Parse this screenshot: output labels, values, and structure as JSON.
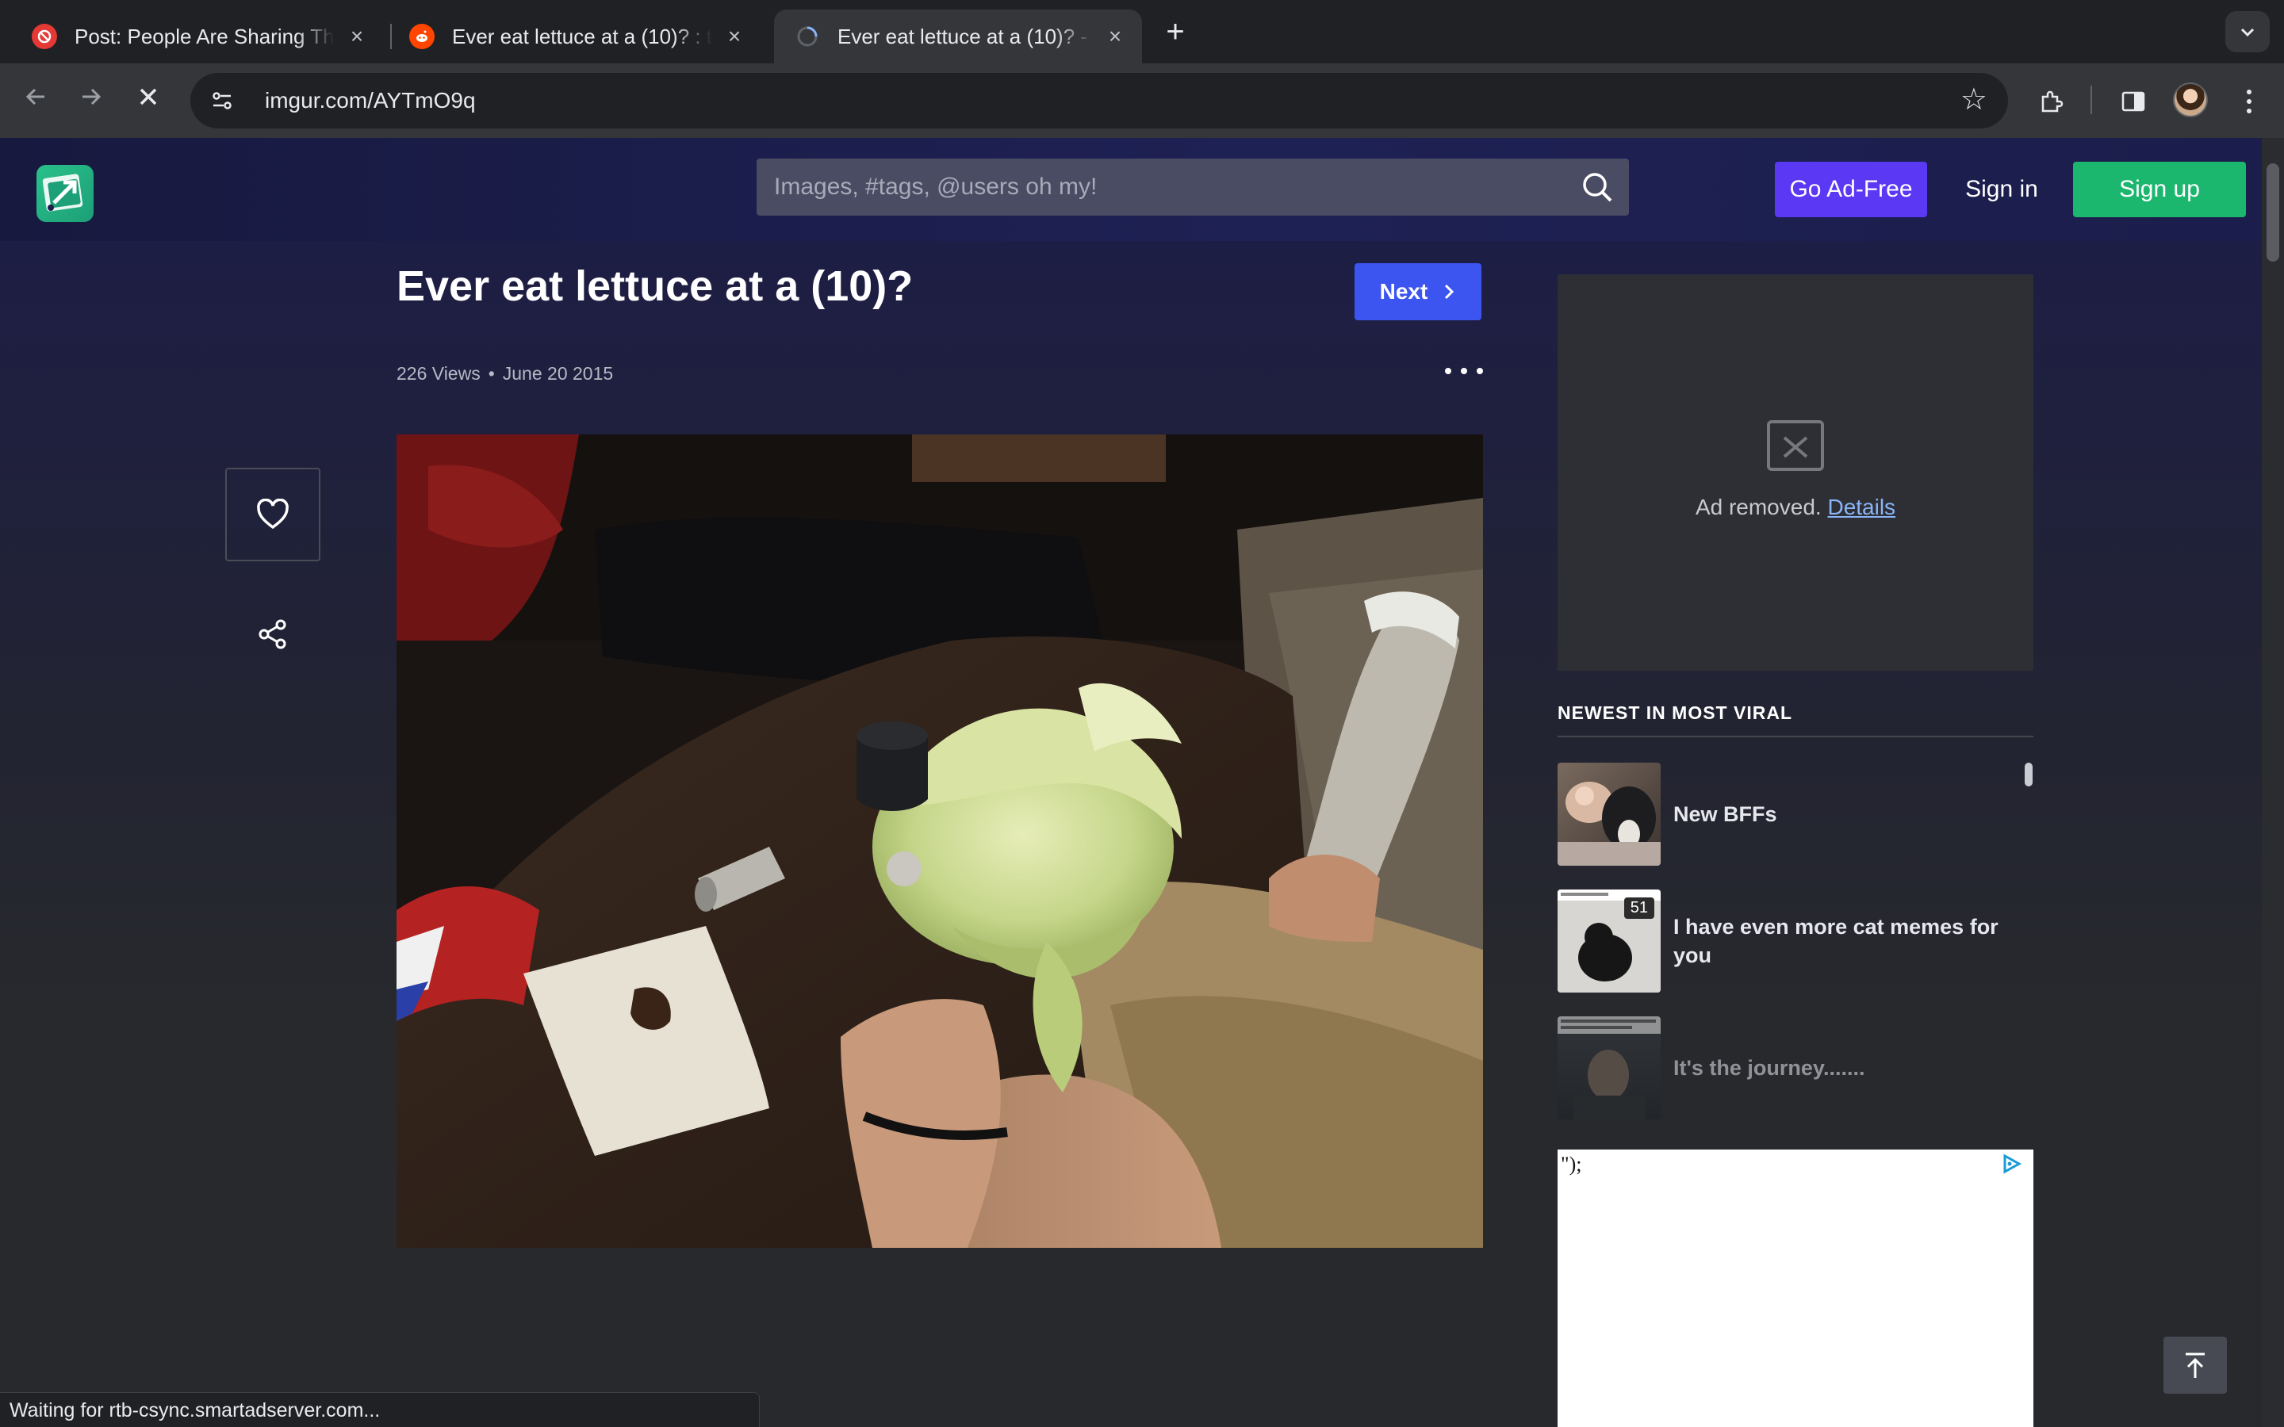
{
  "browser": {
    "tabs": [
      {
        "title": "Post: People Are Sharing The",
        "favicon": "no-entry-icon",
        "favicon_color": "#e53935"
      },
      {
        "title": "Ever eat lettuce at a (10)? : tr",
        "favicon": "reddit-icon",
        "favicon_color": "#ff4500"
      },
      {
        "title": "Ever eat lettuce at a (10)? - I",
        "favicon": "loading-icon",
        "active": true
      }
    ],
    "new_tab_glyph": "+",
    "url": "imgur.com/AYTmO9q",
    "status_text": "Waiting for rtb-csync.smartadserver.com..."
  },
  "header": {
    "search_placeholder": "Images, #tags, @users oh my!",
    "go_ad_free": "Go Ad-Free",
    "sign_in": "Sign in",
    "sign_up": "Sign up"
  },
  "post": {
    "title": "Ever eat lettuce at a (10)?",
    "next_label": "Next",
    "views": "226 Views",
    "meta_separator": "•",
    "date": "June 20 2015"
  },
  "sidebar": {
    "ad_removed_text": "Ad removed.",
    "ad_details_link": "Details",
    "viral_heading": "NEWEST IN MOST VIRAL",
    "viral_items": [
      {
        "title": "New BFFs"
      },
      {
        "title": "I have even more cat memes for you",
        "count": "51"
      },
      {
        "title": "It's the journey......."
      }
    ],
    "ad_fragment": "\");"
  },
  "colors": {
    "accent_purple": "#5b38f4",
    "accent_green": "#1bb76e",
    "accent_blue": "#3d55f0",
    "header_bg": "#1e2154",
    "page_bg": "#27292d"
  }
}
